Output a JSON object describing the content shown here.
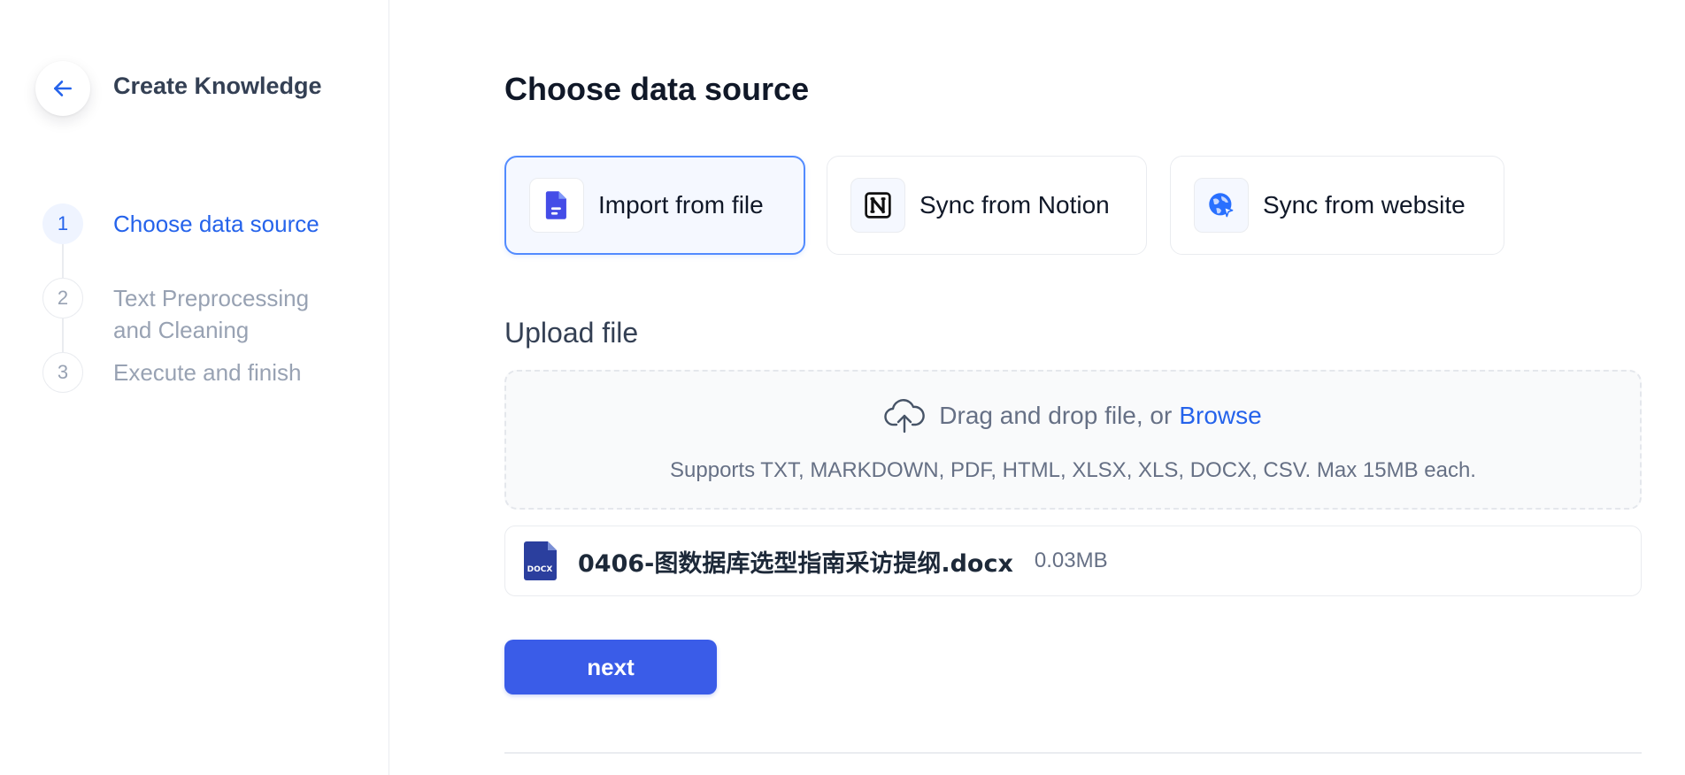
{
  "sidebar": {
    "back_icon": "arrow-left-icon",
    "title": "Create Knowledge",
    "steps": [
      {
        "number": "1",
        "label": "Choose data source",
        "state": "active"
      },
      {
        "number": "2",
        "label": "Text Preprocessing and Cleaning",
        "state": "inactive"
      },
      {
        "number": "3",
        "label": "Execute and finish",
        "state": "inactive"
      }
    ]
  },
  "main": {
    "title": "Choose data source",
    "sources": [
      {
        "label": "Import from file",
        "icon": "file-doc-icon",
        "selected": true
      },
      {
        "label": "Sync from Notion",
        "icon": "notion-icon",
        "selected": false
      },
      {
        "label": "Sync from website",
        "icon": "globe-icon",
        "selected": false
      }
    ],
    "upload": {
      "title": "Upload file",
      "drag_text": "Drag and drop file, or",
      "browse_text": "Browse",
      "support_text": "Supports TXT, MARKDOWN, PDF, HTML, XLSX, XLS, DOCX, CSV. Max 15MB each."
    },
    "files": [
      {
        "type_badge": "DOCX",
        "name": "0406-图数据库选型指南采访提纲.docx",
        "size": "0.03MB"
      }
    ],
    "next_label": "next"
  },
  "colors": {
    "accent": "#2563eb",
    "primary_button": "#3a5ce8",
    "selected_border": "#528bff",
    "docx_icon": "#2b3f9e"
  }
}
